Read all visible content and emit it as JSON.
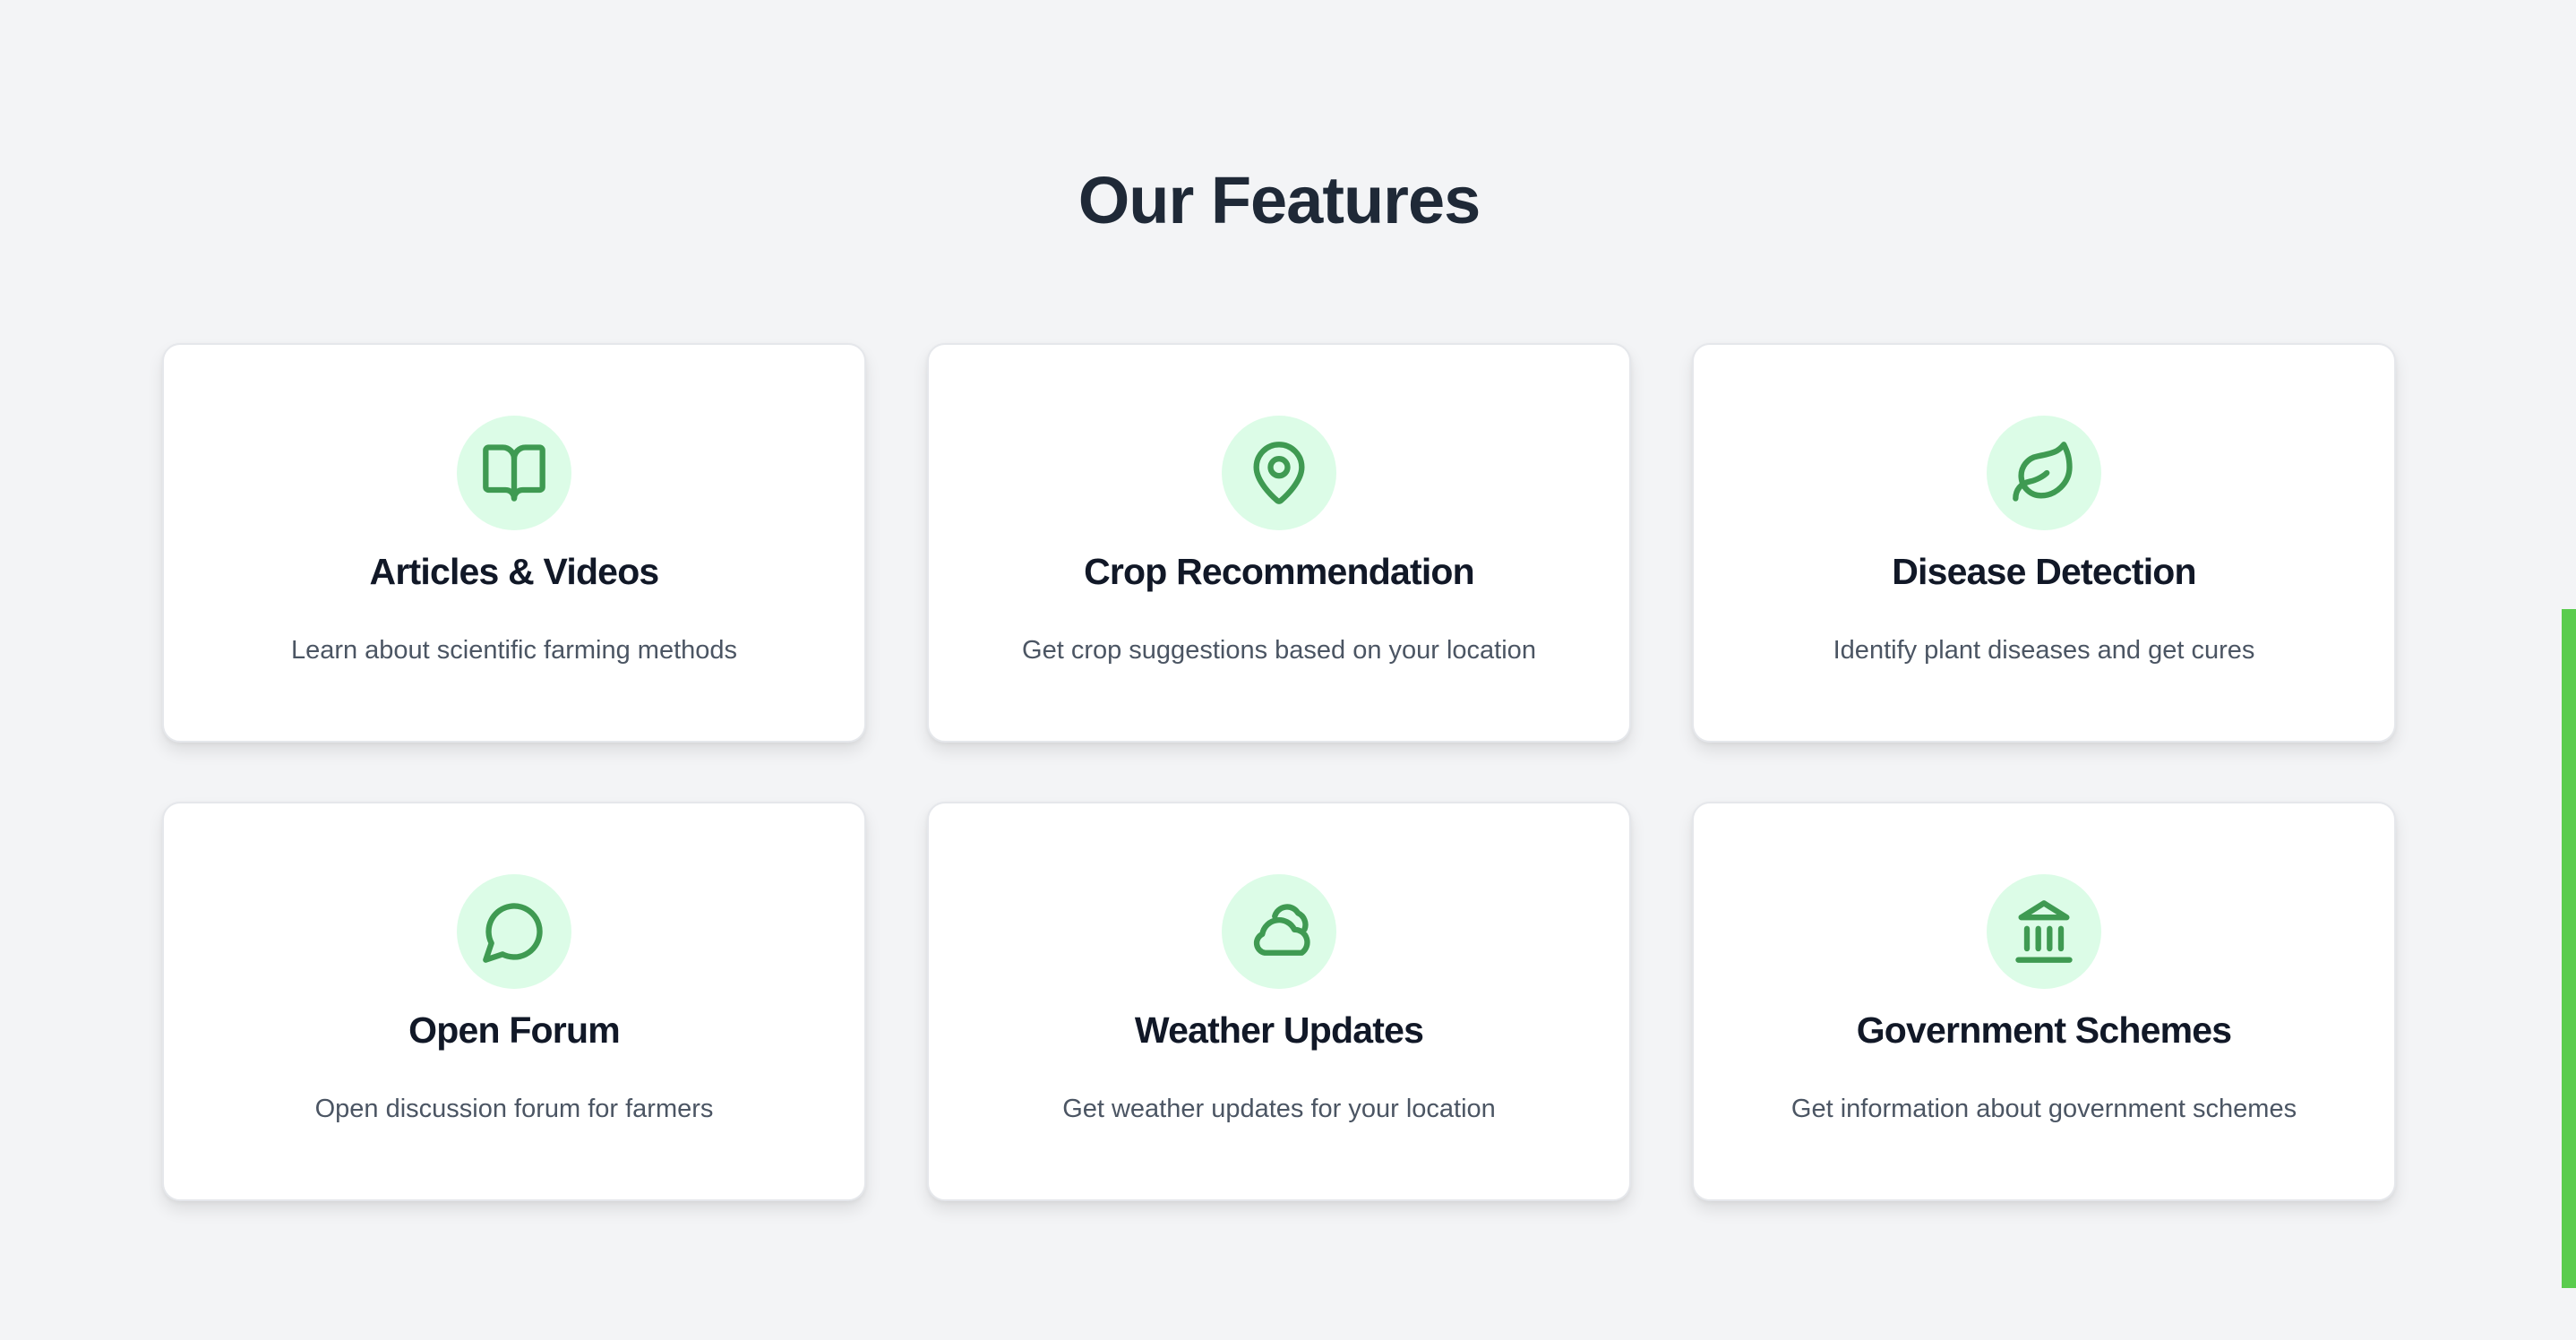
{
  "features": {
    "title": "Our Features",
    "cards": [
      {
        "icon": "book-open-icon",
        "title": "Articles & Videos",
        "description": "Learn about scientific farming methods"
      },
      {
        "icon": "map-pin-icon",
        "title": "Crop Recommendation",
        "description": "Get crop suggestions based on your location"
      },
      {
        "icon": "leaf-icon",
        "title": "Disease Detection",
        "description": "Identify plant diseases and get cures"
      },
      {
        "icon": "chat-bubble-icon",
        "title": "Open Forum",
        "description": "Open discussion forum for farmers"
      },
      {
        "icon": "cloud-sun-icon",
        "title": "Weather Updates",
        "description": "Get weather updates for your location"
      },
      {
        "icon": "landmark-icon",
        "title": "Government Schemes",
        "description": "Get information about government schemes"
      }
    ]
  },
  "colors": {
    "background": "#f3f4f6",
    "accent": "#3f9a52",
    "icon_background": "#dcfce7",
    "scroll_indicator": "#5acc4e"
  }
}
